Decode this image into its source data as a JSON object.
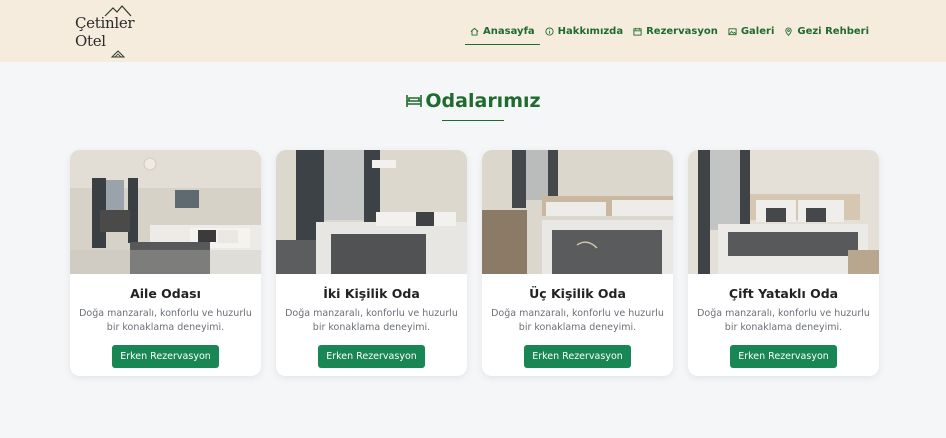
{
  "brand": {
    "name": "Çetinler Otel"
  },
  "nav": {
    "items": [
      {
        "label": "Anasayfa",
        "icon": "home-icon",
        "active": true
      },
      {
        "label": "Hakkımızda",
        "icon": "info-icon",
        "active": false
      },
      {
        "label": "Rezervasyon",
        "icon": "calendar-icon",
        "active": false
      },
      {
        "label": "Galeri",
        "icon": "image-icon",
        "active": false
      },
      {
        "label": "Gezi Rehberi",
        "icon": "map-pin-icon",
        "active": false
      }
    ]
  },
  "rooms": {
    "title": "Odalarımız",
    "icon": "bed-icon",
    "items": [
      {
        "name": "Aile Odası",
        "description": "Doğa manzaralı, konforlu ve huzurlu bir konaklama deneyimi.",
        "button": "Erken Rezervasyon"
      },
      {
        "name": "İki Kişilik Oda",
        "description": "Doğa manzaralı, konforlu ve huzurlu bir konaklama deneyimi.",
        "button": "Erken Rezervasyon"
      },
      {
        "name": "Üç Kişilik Oda",
        "description": "Doğa manzaralı, konforlu ve huzurlu bir konaklama deneyimi.",
        "button": "Erken Rezervasyon"
      },
      {
        "name": "Çift Yataklı Oda",
        "description": "Doğa manzaralı, konforlu ve huzurlu bir konaklama deneyimi.",
        "button": "Erken Rezervasyon"
      }
    ]
  },
  "colors": {
    "accent": "#1e6b2e",
    "button": "#198754",
    "header_bg": "#f6ecdd",
    "page_bg": "#f5f6f8"
  }
}
